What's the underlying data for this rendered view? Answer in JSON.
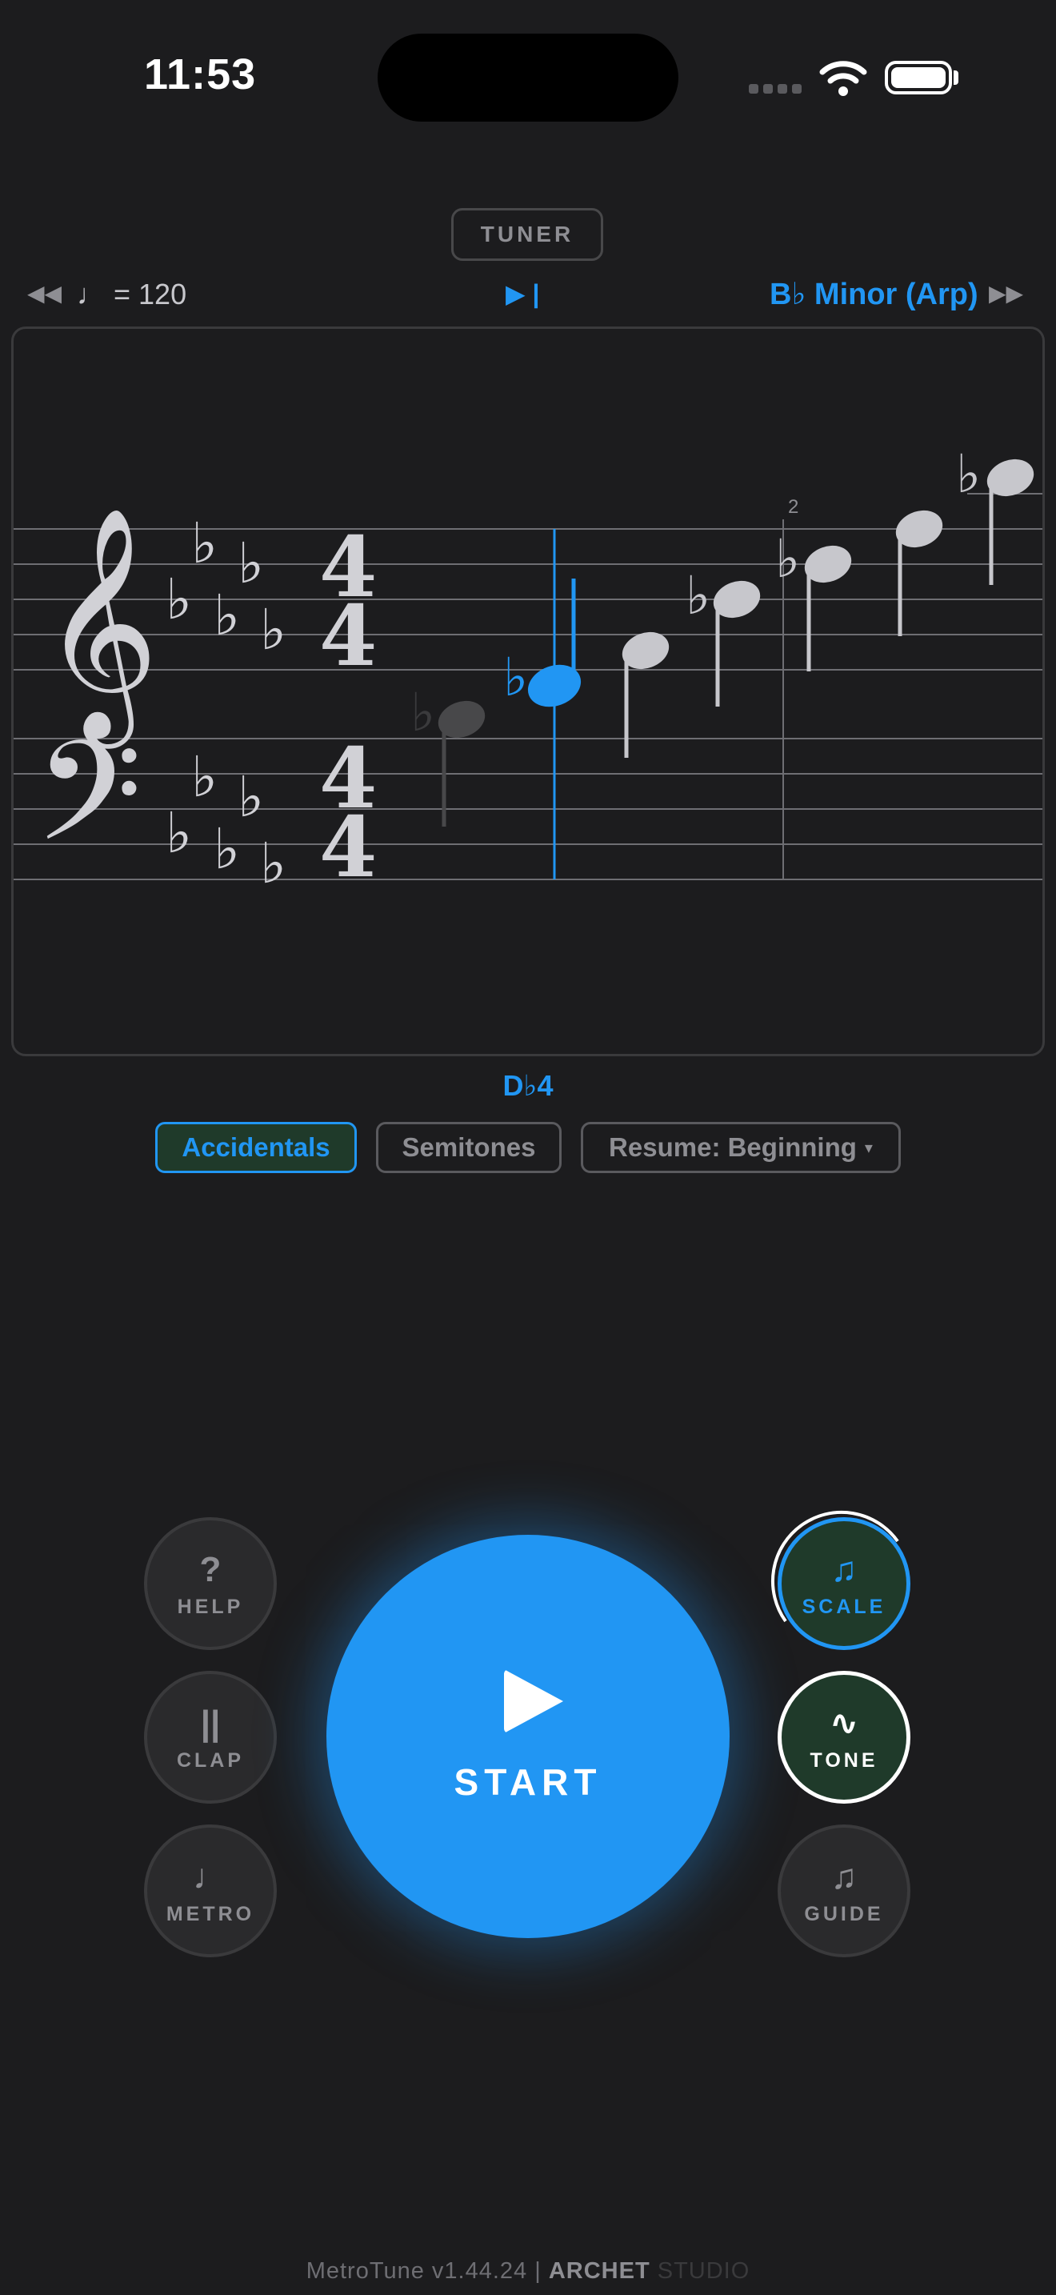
{
  "status_bar": {
    "time": "11:53"
  },
  "tuner": {
    "label": "TUNER"
  },
  "transport": {
    "rewind_icon": "◀◀",
    "tempo": "♩ = 120",
    "playhead_icon": "▶ |",
    "scale_name": "B♭ Minor (Arp)",
    "forward_icon": "▶▶"
  },
  "staff": {
    "key_signature": "B♭ minor (5 flats)",
    "time_signature": "4/4",
    "measure_number": "2",
    "current_note": "D♭4"
  },
  "options": {
    "accidentals": "Accidentals",
    "semitones": "Semitones",
    "resume": "Resume: Beginning",
    "resume_caret": "▾"
  },
  "controls": {
    "help": {
      "icon": "?",
      "label": "HELP"
    },
    "clap": {
      "icon": "||",
      "label": "CLAP"
    },
    "metro": {
      "icon": "♩",
      "label": "METRO"
    },
    "start": {
      "label": "START"
    },
    "scale": {
      "icon": "♫",
      "label": "SCALE"
    },
    "tone": {
      "icon": "∿",
      "label": "TONE"
    },
    "guide": {
      "icon": "♫",
      "label": "GUIDE"
    }
  },
  "footer": {
    "version": "MetroTune v1.44.24 | ",
    "brand": "ARCHET",
    "studio": " STUDIO"
  },
  "colors": {
    "accent": "#2196f3",
    "background": "#1c1c1e",
    "active_fill": "#1f3a2a"
  }
}
